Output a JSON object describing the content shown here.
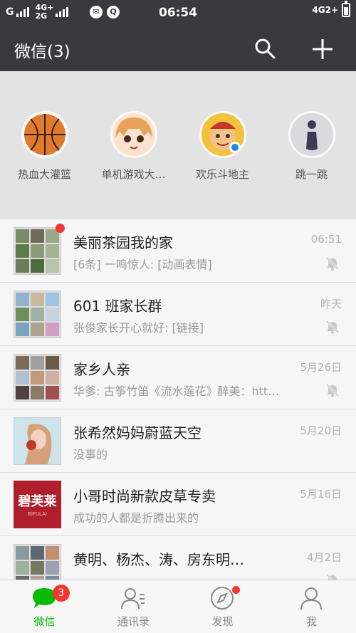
{
  "status_bar": {
    "carrier1": "G",
    "net_top": "4G+",
    "net_bottom": "2G",
    "time": "06:54",
    "right_net": "4G2+"
  },
  "header": {
    "title": "微信(3)",
    "search_icon": "search-icon",
    "add_icon": "plus-icon"
  },
  "mini_programs": [
    {
      "label": "热血大灌篮",
      "icon": "basketball-icon"
    },
    {
      "label": "单机游戏大…",
      "icon": "anime-girl-icon"
    },
    {
      "label": "欢乐斗地主",
      "icon": "cartoon-character-icon"
    },
    {
      "label": "跳一跳",
      "icon": "jump-piece-icon"
    }
  ],
  "chats": [
    {
      "title": "美丽茶园我的家",
      "preview": "[6条] 一鸣惊人: [动画表情]",
      "time": "06:51",
      "muted": true,
      "unread_dot": true
    },
    {
      "title": "601 班家长群",
      "preview": "张俊家长开心就好: [链接]",
      "time": "昨天",
      "muted": true,
      "unread_dot": false
    },
    {
      "title": "家乡人亲",
      "preview": "华爹: 古筝竹笛《流水莲花》醉美：htt…",
      "time": "5月26日",
      "muted": true,
      "unread_dot": false
    },
    {
      "title": "张希然妈妈蔚蓝天空",
      "preview": "没事的",
      "time": "5月20日",
      "muted": false,
      "unread_dot": false
    },
    {
      "title": "小哥时尚新款皮草专卖",
      "preview": "成功的人都是折腾出来的",
      "time": "5月16日",
      "muted": false,
      "unread_dot": false,
      "avatar_text": "碧芙莱",
      "avatar_sub": "BIFULAI"
    },
    {
      "title": "黄明、杨杰、涛、房东明…",
      "preview": "",
      "time": "4月2日",
      "muted": true,
      "unread_dot": false
    }
  ],
  "tabbar": {
    "tabs": [
      {
        "label": "微信",
        "badge": "3",
        "icon": "chat-bubble-icon"
      },
      {
        "label": "通讯录",
        "icon": "contacts-icon"
      },
      {
        "label": "发现",
        "icon": "compass-icon"
      },
      {
        "label": "我",
        "icon": "person-icon"
      }
    ]
  },
  "colors": {
    "header_bg": "#393a3f",
    "accent_green": "#09bb07",
    "badge_red": "#f43530"
  }
}
